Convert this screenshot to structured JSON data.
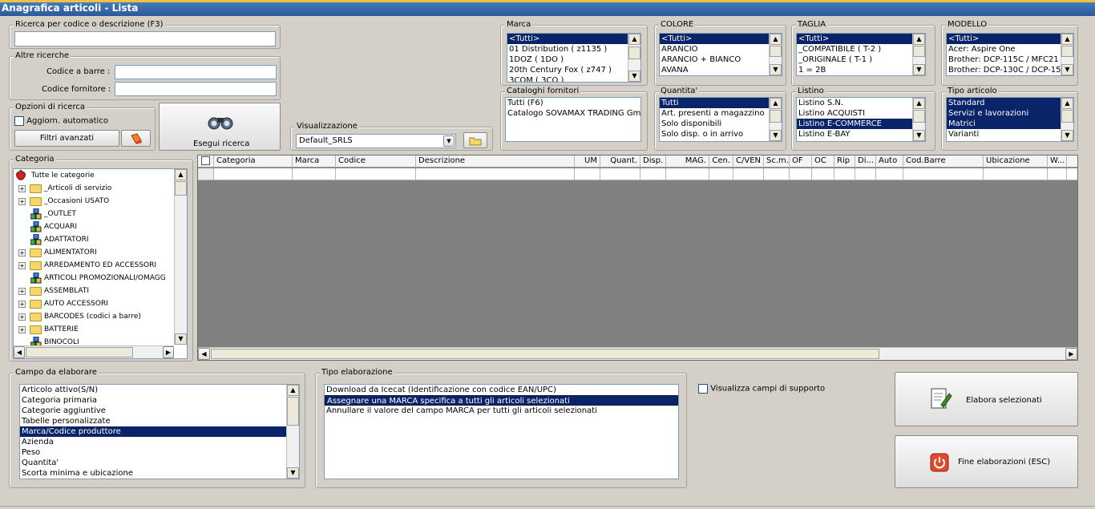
{
  "window": {
    "title": "Anagrafica articoli  - Lista"
  },
  "search": {
    "group_label": "Ricerca per codice o descrizione (F3)",
    "value": ""
  },
  "other_search": {
    "group_label": "Altre ricerche",
    "barcode_label": "Codice a barre :",
    "supplier_code_label": "Codice fornitore :"
  },
  "search_options": {
    "group_label": "Opzioni di ricerca",
    "auto_update_label": "Aggiorn. automatico",
    "advanced_filters_label": "Filtri avanzati"
  },
  "run_search": {
    "label": "Esegui ricerca"
  },
  "view": {
    "group_label": "Visualizzazione",
    "value": "Default_SRLS"
  },
  "brand": {
    "label": "Marca",
    "items": [
      "<Tutti>",
      "01 Distribution ( z1135 )",
      "1DOZ ( 1DO )",
      "20th Century Fox ( z747 )",
      "3COM ( 3CO )"
    ]
  },
  "color": {
    "label": "COLORE",
    "items": [
      "<Tutti>",
      "ARANCIO",
      "ARANCIO + BIANCO",
      "AVANA"
    ]
  },
  "size": {
    "label": "TAGLIA",
    "items": [
      "<Tutti>",
      "_COMPATIBILE ( T-2 )",
      "_ORIGINALE ( T-1 )",
      "1 = 2B"
    ]
  },
  "model": {
    "label": "MODELLO",
    "items": [
      "<Tutti>",
      "Acer: Aspire One",
      "Brother: DCP-115C / MFC21",
      "Brother: DCP-130C / DCP-15"
    ]
  },
  "catalogs": {
    "label": "Cataloghi fornitori",
    "items": [
      "Tutti (F6)",
      "Catalogo SOVAMAX TRADING Gmb"
    ]
  },
  "quantity": {
    "label": "Quantita'",
    "items": [
      "Tutti",
      "Art. presenti a magazzino",
      "Solo disponibili",
      "Solo disp. o in arrivo"
    ]
  },
  "price_list": {
    "label": "Listino",
    "items": [
      "Listino S.N.",
      "Listino ACQUISTI",
      "Listino E-COMMERCE",
      "Listino E-BAY"
    ]
  },
  "item_type": {
    "label": "Tipo articolo",
    "items": [
      "Standard",
      "Servizi e lavorazioni",
      "Matrici",
      "Varianti"
    ]
  },
  "category": {
    "label": "Categoria",
    "items": [
      {
        "label": "Tutte le categorie",
        "icon": "strawberry-icon",
        "expand": false
      },
      {
        "label": "_Articoli di servizio",
        "icon": "folder-icon",
        "expand": true
      },
      {
        "label": "_Occasioni USATO",
        "icon": "folder-icon",
        "expand": true
      },
      {
        "label": "_OUTLET",
        "icon": "cubes-icon",
        "expand": false
      },
      {
        "label": "ACQUARI",
        "icon": "cubes-icon",
        "expand": false
      },
      {
        "label": "ADATTATORI",
        "icon": "cubes-icon",
        "expand": false
      },
      {
        "label": "ALIMENTATORI",
        "icon": "folder-icon",
        "expand": true
      },
      {
        "label": "ARREDAMENTO ED ACCESSORI",
        "icon": "folder-icon",
        "expand": true
      },
      {
        "label": "ARTICOLI PROMOZIONALI/OMAGG",
        "icon": "cubes-icon",
        "expand": false
      },
      {
        "label": "ASSEMBLATI",
        "icon": "folder-icon",
        "expand": true
      },
      {
        "label": "AUTO ACCESSORI",
        "icon": "folder-icon",
        "expand": true
      },
      {
        "label": "BARCODES (codici a barre)",
        "icon": "folder-icon",
        "expand": true
      },
      {
        "label": "BATTERIE",
        "icon": "folder-icon",
        "expand": true
      },
      {
        "label": "BINOCOLI",
        "icon": "cubes-icon",
        "expand": false
      }
    ]
  },
  "grid": {
    "columns": [
      "Categoria",
      "Marca",
      "Codice",
      "Descrizione",
      "UM",
      "Quant.",
      "Disp.",
      "MAG.",
      "Cen.",
      "C/VEN",
      "Sc.m.",
      "OF",
      "OC",
      "Rip",
      "Di...",
      "Auto",
      "Cod.Barre",
      "Ubicazione",
      "W..."
    ]
  },
  "field_to_process": {
    "label": "Campo da elaborare",
    "items": [
      "Articolo attivo(S/N)",
      "Categoria primaria",
      "Categorie aggiuntive",
      "Tabelle personalizzate",
      "Marca/Codice produttore",
      "Azienda",
      "Peso",
      "Quantita'",
      "Scorta minima e ubicazione"
    ],
    "selected": 4
  },
  "processing_type": {
    "label": "Tipo elaborazione",
    "items": [
      "Download da Icecat (Identificazione con codice EAN/UPC)",
      "Assegnare una MARCA specifica a tutti gli articoli selezionati",
      "Annullare il valore del campo MARCA per tutti gli articoli selezionati"
    ],
    "selected": 1
  },
  "support_fields": {
    "label": "Visualizza campi di supporto"
  },
  "actions": {
    "process_selected": "Elabora selezionati",
    "end_processing": "Fine elaborazioni (ESC)"
  },
  "colors": {
    "selection": "#0a246a",
    "titlebar": "#3566ac",
    "grid_bg": "#808080"
  }
}
